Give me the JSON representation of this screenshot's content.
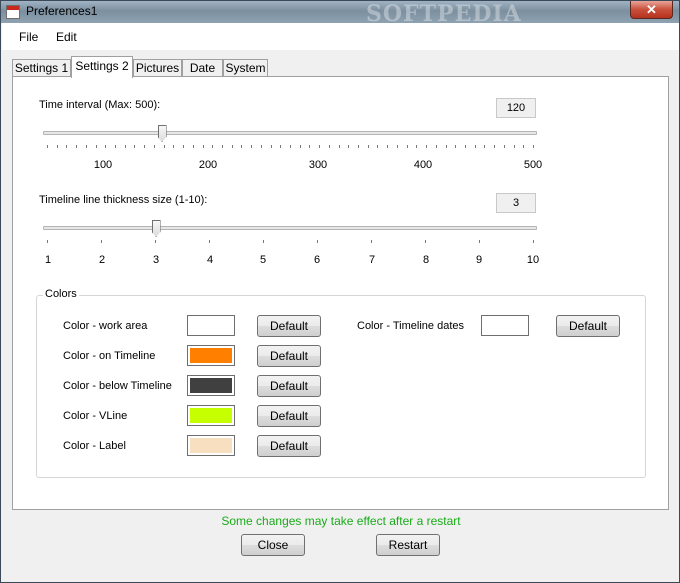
{
  "window": {
    "title": "Preferences1",
    "watermark": "SOFTPEDIA",
    "close_glyph": "✕"
  },
  "menu": {
    "items": [
      "File",
      "Edit"
    ]
  },
  "tabs": [
    {
      "label": "Settings 1",
      "active": false
    },
    {
      "label": "Settings 2",
      "active": true
    },
    {
      "label": "Pictures",
      "active": false
    },
    {
      "label": "Date",
      "active": false
    },
    {
      "label": "System",
      "active": false
    }
  ],
  "time_interval": {
    "label": "Time interval (Max: 500):",
    "value": "120",
    "min": 0,
    "max": 500,
    "current": 120,
    "tick_labels": [
      "100",
      "200",
      "300",
      "400",
      "500"
    ]
  },
  "thickness": {
    "label": "Timeline line thickness size (1-10):",
    "value": "3",
    "min": 1,
    "max": 10,
    "current": 3,
    "tick_labels": [
      "1",
      "2",
      "3",
      "4",
      "5",
      "6",
      "7",
      "8",
      "9",
      "10"
    ]
  },
  "colors": {
    "group_title": "Colors",
    "default_label": "Default",
    "items": [
      {
        "label": "Color - work area",
        "swatch": "#ffffff"
      },
      {
        "label": "Color - on Timeline",
        "swatch": "#ff7f00"
      },
      {
        "label": "Color - below Timeline",
        "swatch": "#404040"
      },
      {
        "label": "Color - VLine",
        "swatch": "#c6ff00"
      },
      {
        "label": "Color - Label",
        "swatch": "#f7dfbf"
      }
    ],
    "right_item": {
      "label": "Color - Timeline dates",
      "swatch": "#ffffff"
    }
  },
  "footer": {
    "message": "Some changes may take effect after a restart",
    "close_label": "Close",
    "restart_label": "Restart"
  }
}
